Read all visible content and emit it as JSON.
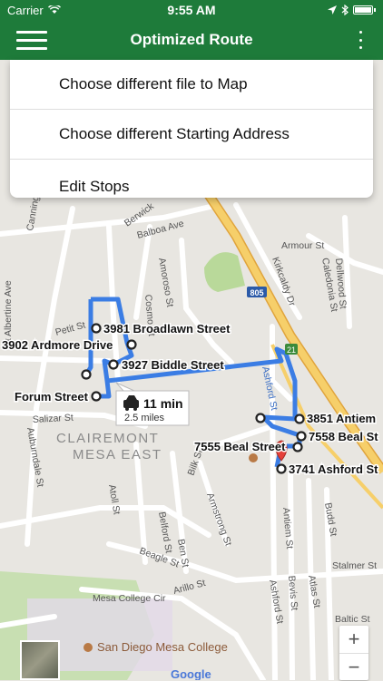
{
  "status": {
    "carrier": "Carrier",
    "time": "9:55 AM"
  },
  "appbar": {
    "title": "Optimized Route"
  },
  "menu": {
    "items": [
      "Choose different file to Map",
      "Choose different Starting Address",
      "Edit Stops"
    ]
  },
  "route": {
    "duration": "11 min",
    "distance": "2.5 miles"
  },
  "stops": [
    "3981 Broadlawn Street",
    "3902 Ardmore Drive",
    "3927 Biddle Street",
    "Forum Street",
    "3851 Antiem",
    "7558 Beal St",
    "7555 Beal Street",
    "3741 Ashford St"
  ],
  "map": {
    "streets": [
      "Canning",
      "Berwick",
      "Balboa Ave",
      "Armour St",
      "Mt Albertine Ave",
      "Petit St",
      "Cosmo St",
      "Amoroso St",
      "Kirkcaldy Dr",
      "Caledonia St",
      "Dellwood St",
      "Salizar St",
      "Auburndale St",
      "Atoll St",
      "Belford St",
      "Ben St",
      "Beagle St",
      "Armstrong St",
      "Bilk St",
      "Ashford St",
      "Antiem St",
      "Bevis St",
      "Atlas St",
      "Budd St",
      "Stalmer St",
      "Mesa College Cir",
      "Arillo St",
      "Baltic St",
      "Ashford St"
    ],
    "neighborhood": [
      "CLAIREMONT",
      "MESA EAST"
    ],
    "poi": "San Diego Mesa College",
    "freeway_shields": [
      "805",
      "21"
    ],
    "google": "Google"
  },
  "zoom": {
    "in": "+",
    "out": "−"
  },
  "colors": {
    "appbar": "#1e7b3a",
    "route": "#3b7de4",
    "freeway": "#f2c255",
    "park": "#b9d99a"
  }
}
